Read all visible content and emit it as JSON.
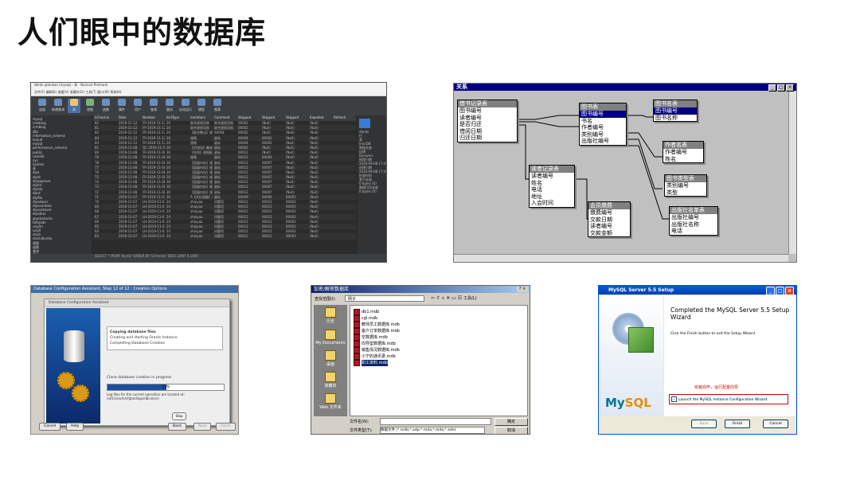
{
  "title": "人们眼中的数据库",
  "navicat": {
    "window_title": "dbrds @lankao (mysql) - 表 - Navicat Premium",
    "menu": "文件(F)  编辑(E)  查看(V)  收藏夹(O)  工具(T)  窗口(W)  帮助(H)",
    "toolbar": [
      "连接",
      "新建查询",
      "表",
      "视图",
      "函数",
      "事件",
      "用户",
      "查询",
      "备份",
      "自动运行",
      "模型",
      "图表"
    ],
    "sidebar": [
      "mysql",
      "cmsblog",
      "crmblog",
      "dbs",
      "information_schema",
      "lanjud",
      "mysql",
      "performance_schema",
      "public",
      "sameEl",
      "sys",
      "lianlian",
      "表",
      "dlya",
      "dlydl",
      "dlyapprove",
      "dlyhis",
      "dlyrdy",
      "dlyst",
      "dlyfile",
      "dlysduser",
      "dlyuserdata",
      "dlyvorkover",
      "dlyother",
      "goodsstocks",
      "tofirjade",
      "unyitn",
      "unyit",
      "stock",
      "stockdlyndu",
      "视图",
      "函数",
      "查询",
      "备份"
    ],
    "columns": [
      "kCheckin",
      "Date",
      "Number",
      "keilType",
      "memberz",
      "Comment",
      "Skipped",
      "Skipped",
      "Skipped",
      "Expeded",
      "Refresh"
    ],
    "rows": [
      [
        "82",
        "2019-11-12",
        "FP-2019-11-12-008",
        "20",
        "联合规程导航",
        "联合规程导航",
        "00002",
        "(Null)",
        "(Null)",
        "(Null)",
        ""
      ],
      [
        "81",
        "2019-11-12",
        "FP-2019-11-12-006",
        "20",
        "联合规程导航",
        "联合规程导航",
        "00002",
        "(Null)",
        "(Null)",
        "(Null)",
        ""
      ],
      [
        "83",
        "2019-11-12",
        "FP-2019-11-12-005",
        "20",
        "【联合整洁】规格类型",
        "00004",
        "00002",
        "(Null)",
        "(Null)",
        "(Null)",
        ""
      ],
      [
        "84",
        "2019-11-12",
        "FP-2019-11-12-003",
        "20",
        "规格",
        "副标",
        "00004",
        "00002",
        "(Null)",
        "(Null)",
        ""
      ],
      [
        "84",
        "2019-11-12",
        "FP-2019-11-12-007",
        "20",
        "规格",
        "副标",
        "00004",
        "00002",
        "(Null)",
        "(Null)",
        ""
      ],
      [
        "81",
        "2019-11-08",
        "QC-2019-11-08-001",
        "30",
        "【对流化】集成人对流化",
        "副标",
        "00002",
        "(Null)",
        "(Null)",
        "(Null)",
        ""
      ],
      [
        "80",
        "2019-11-08",
        "FP-2019-11-08-007",
        "30",
        "【合同】规格配置",
        "副标",
        "00012",
        "(Null)",
        "(Null)",
        "(Null)",
        ""
      ],
      [
        "79",
        "2019-11-08",
        "FP-2019-11-08-021",
        "30",
        "规格",
        "副标",
        "00012",
        "00006",
        "(Null)",
        "(Null)",
        ""
      ],
      [
        "78",
        "2019-11-08",
        "FP-2019-11-08-006",
        "30",
        "【容器内存】规格配置",
        "副标",
        "00012",
        "00007",
        "(Null)",
        "(Null)",
        ""
      ],
      [
        "77",
        "2019-11-08",
        "FP-2019-11-08-005",
        "30",
        "【容器内存】规格配置",
        "副标",
        "00012",
        "00007",
        "(Null)",
        "(Null)",
        ""
      ],
      [
        "76",
        "2019-11-08",
        "FP-2019-11-08-004",
        "30",
        "【容器内存】规格配置",
        "副标",
        "00012",
        "00007",
        "(Null)",
        "(Null)",
        ""
      ],
      [
        "75",
        "2019-11-08",
        "FP-2019-11-08-003",
        "30",
        "【容器内存】规格配置",
        "副标",
        "00012",
        "00007",
        "(Null)",
        "(Null)",
        ""
      ],
      [
        "74",
        "2019-11-08",
        "FP-2019-11-08-002",
        "30",
        "【容器内存】规格配置",
        "副标",
        "00012",
        "00007",
        "(Null)",
        "(Null)",
        ""
      ],
      [
        "73",
        "2019-11-08",
        "FP-2019-11-08-001",
        "30",
        "【容器内存】规格配置",
        "副标",
        "00012",
        "00007",
        "(Null)",
        "(Null)",
        ""
      ],
      [
        "72",
        "2019-11-08",
        "FP-2019-11-08-000",
        "30",
        "【容器内存】规格配置",
        "副标",
        "00012",
        "00007",
        "(Null)",
        "(Null)",
        ""
      ],
      [
        "71",
        "2019-11-07",
        "FP-2019-11-07-028",
        "30",
        "A【对比测量】对照组目 (21",
        "副标",
        "00009",
        "00006",
        "00001",
        "(Null)",
        ""
      ],
      [
        "70",
        "2019-11-07",
        "LH-2019-11-07-026",
        "24",
        "zhaiyao",
        "问题项",
        "00012",
        "00012",
        "00003",
        "(Null)",
        ""
      ],
      [
        "69",
        "2019-11-07",
        "LH-2019-11-07-025",
        "24",
        "zhaiyao",
        "问题项",
        "00012",
        "00012",
        "00003",
        "(Null)",
        ""
      ],
      [
        "68",
        "2019-11-07",
        "LH-2019-11-07-024",
        "24",
        "zhaiyao",
        "问题项",
        "00012",
        "00012",
        "00003",
        "(Null)",
        ""
      ],
      [
        "67",
        "2019-11-07",
        "LH-2019-11-07-023",
        "24",
        "zhaiyao",
        "问题项",
        "00012",
        "00012",
        "00003",
        "(Null)",
        ""
      ],
      [
        "66",
        "2019-11-07",
        "LH-2019-11-07-022",
        "24",
        "zhaiyao",
        "问题项",
        "00012",
        "00012",
        "00003",
        "(Null)",
        ""
      ],
      [
        "65",
        "2019-11-07",
        "LH-2019-11-07-021",
        "24",
        "zhaiyao",
        "问题项",
        "00012",
        "00012",
        "00003",
        "(Null)",
        ""
      ],
      [
        "64",
        "2019-11-07",
        "LH-2019-11-07-020",
        "24",
        "zhaiyao",
        "问题项",
        "00012",
        "00012",
        "00003",
        "(Null)",
        ""
      ],
      [
        "63",
        "2019-11-07",
        "LH-2019-11-07-019",
        "24",
        "zhaiyao",
        "问题项",
        "00012",
        "00012",
        "00003",
        "(Null)",
        ""
      ]
    ],
    "info_title": "dlyrds",
    "info_lines": [
      "行",
      "表",
      "InnoDB",
      "数据长度",
      "自增",
      "Dynamic",
      "修改日期",
      "2020-09-08 17:48:06",
      "创建日期",
      "2020-09-08 17:48:06",
      "检查时间",
      "索引长度",
      "0 bytes (0)",
      "数据可用长度",
      "0 bytes (0)"
    ],
    "status": "SELECT * FROM 'dlyrds' ORDER BY 'kCheckin' DESC LIMIT 0,1000"
  },
  "erd": {
    "window_title": "关系",
    "entities": [
      {
        "title": "借书记录表",
        "fields": [
          "图书编号",
          "读者编号",
          "是否归还",
          "借阅日期",
          "归还日期"
        ]
      },
      {
        "title": "图书表",
        "fields": [
          "图书编号",
          "书名",
          "作者编号",
          "类别编号",
          "出版社编号"
        ]
      },
      {
        "title": "图书名表",
        "fields": [
          "图书编号",
          "图书名称"
        ]
      },
      {
        "title": "作者名表",
        "fields": [
          "作者编号",
          "姓名"
        ]
      },
      {
        "title": "读者记录表",
        "fields": [
          "读者编号",
          "姓名",
          "电话",
          "地址",
          "入会时间"
        ]
      },
      {
        "title": "图书类型表",
        "fields": [
          "类别编号",
          "类型"
        ]
      },
      {
        "title": "会员缴费",
        "fields": [
          "缴费编号",
          "交款日期",
          "读者编号",
          "交款金额"
        ]
      },
      {
        "title": "出版社名单表",
        "fields": [
          "出版社编号",
          "出版社名称",
          "电话"
        ]
      }
    ]
  },
  "oracle": {
    "outer_title": "Database Configuration Assistant, Step 12 of 12 : Creation Options",
    "dialog_title": "Database Configuration Assistant",
    "steps": [
      "Copying database files",
      "Creating and starting Oracle Instance",
      "Completing Database Creation"
    ],
    "progress_label": "Clone database creation in progress",
    "progress_pct": 0.51,
    "progress_text": "51%",
    "log_text": "Log files for the current operation are located at: /u01/oracle/cfgtoollogs/dbca/orcl",
    "stop_label": "Stop",
    "cancel_label": "Cancel",
    "help_label": "Help",
    "back_label": "Back",
    "next_label": "Next",
    "finish_label": "Finish"
  },
  "access": {
    "window_title": "加密/解密数据库",
    "lookin_label": "查找范围(I):",
    "lookin_value": "例子",
    "tools_label": "工具(L)",
    "places": [
      "历史",
      "My Documents",
      "桌面",
      "收藏夹",
      "Web 文件夹"
    ],
    "files": [
      "db1.mdb",
      "cgl.mdb",
      "教师员工数据库.mdb",
      "客户订单数据库.mdb",
      "空数据库.mdb",
      "向导型数据库.mdb",
      "销售情况数据库.mdb",
      "小宁的通讯录.mdb",
      "职工资料.mdb"
    ],
    "selected_index": 8,
    "filename_label": "文件名(N):",
    "filetype_label": "文件类型(T):",
    "filetype_value": "数据文件 (*.mdb;*.adp;*.mda;*.mde;*.ade)",
    "ok_label": "确定",
    "cancel_label": "取消"
  },
  "mysql": {
    "window_title": "MySQL Server 5.5 Setup",
    "heading": "Completed the MySQL Server 5.5 Setup Wizard",
    "body": "Click the Finish button to exit the Setup Wizard.",
    "note": "安装完毕，运行配置向导",
    "checkbox_label": "Launch the MySQL Instance Configuration Wizard",
    "back_label": "Back",
    "finish_label": "Finish",
    "cancel_label": "Cancel",
    "logo_my": "My",
    "logo_sql": "SQL"
  }
}
